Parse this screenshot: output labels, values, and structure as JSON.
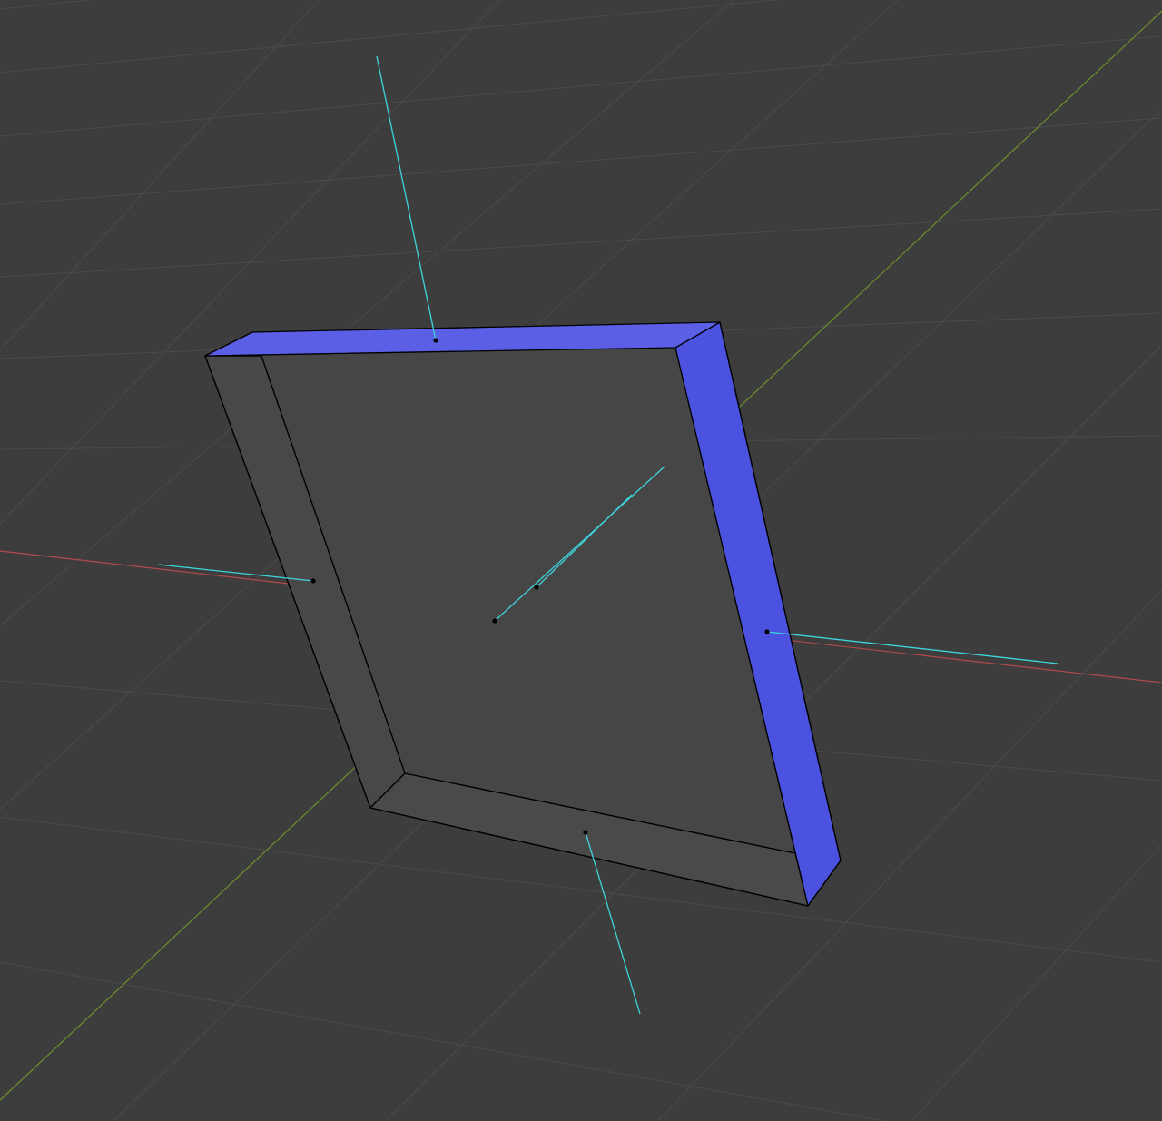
{
  "viewport": {
    "view_name": "3d-viewport",
    "colors": {
      "background": "#3d3d3d",
      "grid_line": "#4d4d4d",
      "axis_x": "#b04a4a",
      "axis_y": "#6a8f2c",
      "normal_line": "#3fd4dc",
      "selected_face": "#4b52e0",
      "selected_face_top": "#5a5fe6",
      "unselected_face": "#4a4a4a",
      "edge": "#000000",
      "face_dot": "#000000"
    },
    "mesh": {
      "name": "frame-mesh",
      "selected_faces": [
        "top-face",
        "right-face"
      ],
      "face_dots": 6,
      "normals_shown": true
    }
  }
}
